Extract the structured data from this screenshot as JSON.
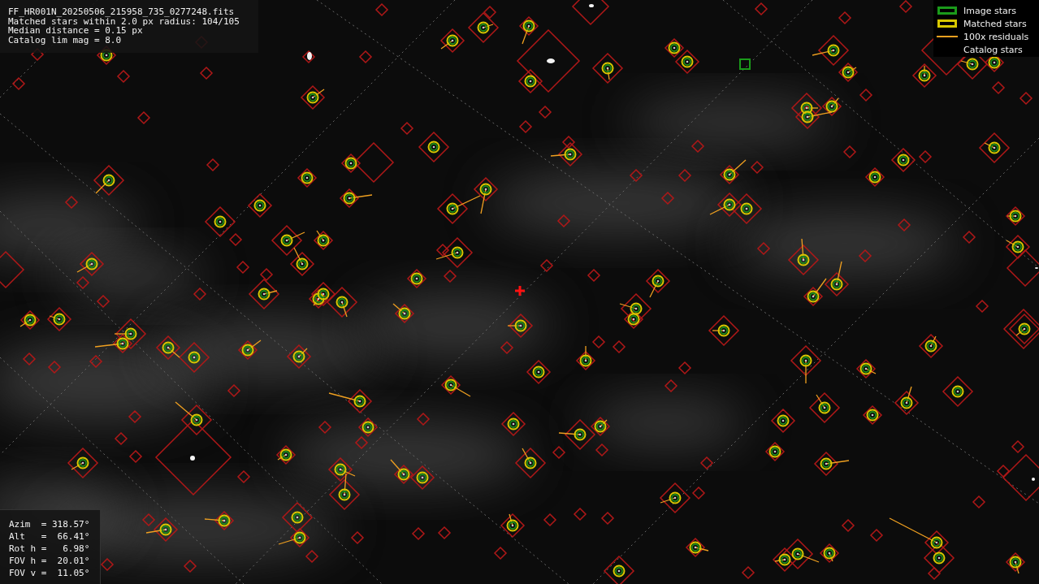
{
  "file_info": {
    "lines": [
      "FF_HR001N_20250506_215958_735_0277248.fits",
      "Matched stars within 2.0 px radius: 104/105",
      "Median distance = 0.15 px",
      "Catalog lim mag = 8.0"
    ]
  },
  "legend": {
    "items": [
      {
        "kind": "box",
        "color": "#1a9a1a",
        "label": "Image stars"
      },
      {
        "kind": "ring",
        "color": "#d8c800",
        "label": "Matched stars"
      },
      {
        "kind": "line",
        "color": "#f0a020",
        "label": "100x residuals"
      },
      {
        "kind": "none",
        "label": "Catalog stars"
      }
    ]
  },
  "pointing": {
    "lines": [
      "Azim  = 318.57°",
      "Alt   =  66.41°",
      "Rot h =   6.98°",
      "FOV h =  20.01°",
      "FOV v =  11.05°"
    ]
  }
}
